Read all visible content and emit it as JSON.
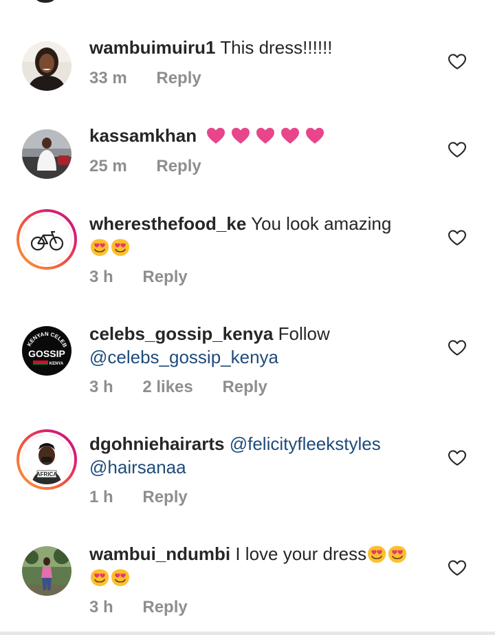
{
  "comments": [
    {
      "username": "wambuimuiru1",
      "text": "This dress!!!!!!",
      "time": "33 m",
      "reply": "Reply"
    },
    {
      "username": "kassamkhan",
      "emoji": [
        "pink-heart",
        "pink-heart",
        "pink-heart",
        "pink-heart",
        "pink-heart"
      ],
      "time": "25 m",
      "reply": "Reply"
    },
    {
      "username": "wheresthefood_ke",
      "text": "You look amazing",
      "emoji": [
        "heart-eyes",
        "heart-eyes"
      ],
      "time": "3 h",
      "reply": "Reply"
    },
    {
      "username": "celebs_gossip_kenya",
      "text": "Follow",
      "mention": "@celebs_gossip_kenya",
      "avatar_text": [
        "KENYAN CELEBS",
        "GOSSIP",
        "KENYA"
      ],
      "time": "3 h",
      "likes": "2 likes",
      "reply": "Reply"
    },
    {
      "username": "dgohniehairarts",
      "mention1": "@felicityfleekstyles",
      "mention2": "@hairsanaa",
      "avatar_text": "AFRICA",
      "time": "1 h",
      "reply": "Reply"
    },
    {
      "username": "wambui_ndumbi",
      "text": "I love your dress",
      "emoji": [
        "heart-eyes",
        "heart-eyes",
        "heart-eyes",
        "heart-eyes"
      ],
      "time": "3 h",
      "reply": "Reply"
    }
  ],
  "colors": {
    "username": "#262626",
    "meta": "#8e8e8e",
    "mention": "#1e4b7a",
    "heart_pink": "#e8458b"
  }
}
